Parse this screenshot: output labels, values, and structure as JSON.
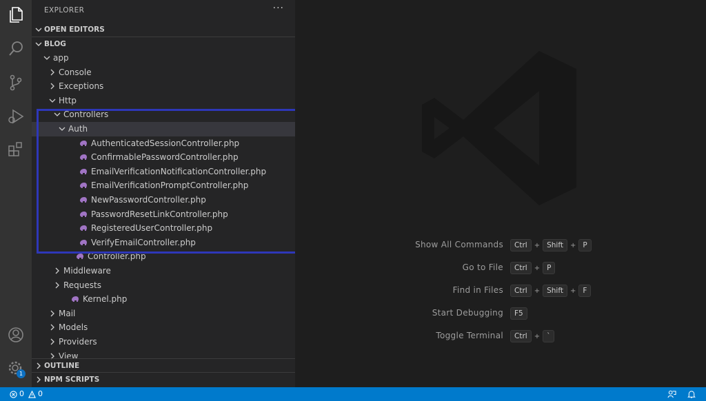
{
  "activity_bar": {
    "icons": [
      "explorer-icon",
      "search-icon",
      "source-control-icon",
      "run-debug-icon",
      "extensions-icon",
      "account-icon",
      "settings-gear-icon"
    ],
    "badge": "1"
  },
  "explorer": {
    "title": "EXPLORER",
    "more": "···",
    "sections": {
      "open_editors": "OPEN EDITORS",
      "project": "BLOG",
      "outline": "OUTLINE",
      "npm_scripts": "NPM SCRIPTS"
    },
    "tree": [
      {
        "label": "app",
        "kind": "folder-open",
        "depth": 1
      },
      {
        "label": "Console",
        "kind": "folder",
        "depth": 2
      },
      {
        "label": "Exceptions",
        "kind": "folder",
        "depth": 2
      },
      {
        "label": "Http",
        "kind": "folder-open",
        "depth": 2
      },
      {
        "label": "Controllers",
        "kind": "folder-open",
        "depth": 3
      },
      {
        "label": "Auth",
        "kind": "folder-open",
        "depth": 4,
        "selected": true
      },
      {
        "label": "AuthenticatedSessionController.php",
        "kind": "php",
        "depth": 5
      },
      {
        "label": "ConfirmablePasswordController.php",
        "kind": "php",
        "depth": 5
      },
      {
        "label": "EmailVerificationNotificationController.php",
        "kind": "php",
        "depth": 5
      },
      {
        "label": "EmailVerificationPromptController.php",
        "kind": "php",
        "depth": 5
      },
      {
        "label": "NewPasswordController.php",
        "kind": "php",
        "depth": 5
      },
      {
        "label": "PasswordResetLinkController.php",
        "kind": "php",
        "depth": 5
      },
      {
        "label": "RegisteredUserController.php",
        "kind": "php",
        "depth": 5
      },
      {
        "label": "VerifyEmailController.php",
        "kind": "php",
        "depth": 5
      },
      {
        "label": "Controller.php",
        "kind": "php",
        "depth": 4
      },
      {
        "label": "Middleware",
        "kind": "folder",
        "depth": 3
      },
      {
        "label": "Requests",
        "kind": "folder",
        "depth": 3
      },
      {
        "label": "Kernel.php",
        "kind": "php",
        "depth": 3
      },
      {
        "label": "Mail",
        "kind": "folder",
        "depth": 2
      },
      {
        "label": "Models",
        "kind": "folder",
        "depth": 2
      },
      {
        "label": "Providers",
        "kind": "folder",
        "depth": 2
      },
      {
        "label": "View",
        "kind": "folder",
        "depth": 2
      }
    ]
  },
  "editor": {
    "watermark_icon": "vscode-logo-icon",
    "shortcuts": [
      {
        "label": "Show All Commands",
        "keys": [
          "Ctrl",
          "Shift",
          "P"
        ]
      },
      {
        "label": "Go to File",
        "keys": [
          "Ctrl",
          "P"
        ]
      },
      {
        "label": "Find in Files",
        "keys": [
          "Ctrl",
          "Shift",
          "F"
        ]
      },
      {
        "label": "Start Debugging",
        "keys": [
          "F5"
        ]
      },
      {
        "label": "Toggle Terminal",
        "keys": [
          "Ctrl",
          "`"
        ]
      }
    ]
  },
  "status_bar": {
    "errors": "0",
    "warnings": "0",
    "icons": [
      "error-icon",
      "warning-icon",
      "feedback-icon",
      "bell-icon"
    ]
  },
  "colors": {
    "activity_bar": "#333333",
    "sidebar": "#252526",
    "editor": "#1e1e1e",
    "status_bar": "#007acc",
    "highlight": "#2e37b8",
    "php_icon": "#a074c4"
  }
}
